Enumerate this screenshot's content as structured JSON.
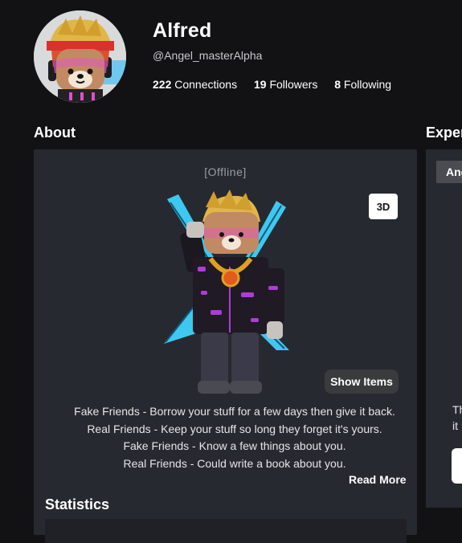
{
  "profile": {
    "display_name": "Alfred",
    "username": "@Angel_masterAlpha",
    "connections": {
      "count": "222",
      "label": "Connections"
    },
    "followers": {
      "count": "19",
      "label": "Followers"
    },
    "following": {
      "count": "8",
      "label": "Following"
    }
  },
  "about": {
    "title": "About",
    "status": "[Offline]",
    "view_toggle": "3D",
    "show_items": "Show Items",
    "blurb": [
      "Fake Friends - Borrow your stuff for a few days then give it back.",
      "Real Friends - Keep your stuff so long they forget it's yours.",
      "Fake Friends - Know a few things about you.",
      "Real Friends - Could write a book about you."
    ],
    "read_more": "Read More"
  },
  "statistics": {
    "title": "Statistics"
  },
  "experiences": {
    "title": "Exper",
    "tab": "Ang",
    "text_lines": [
      "Th",
      "it"
    ]
  },
  "colors": {
    "background": "#121215",
    "card": "#272930",
    "button": "#393b3d",
    "accent_sword": "#3ec8f0",
    "avatar_glow": "#b03bd8"
  }
}
